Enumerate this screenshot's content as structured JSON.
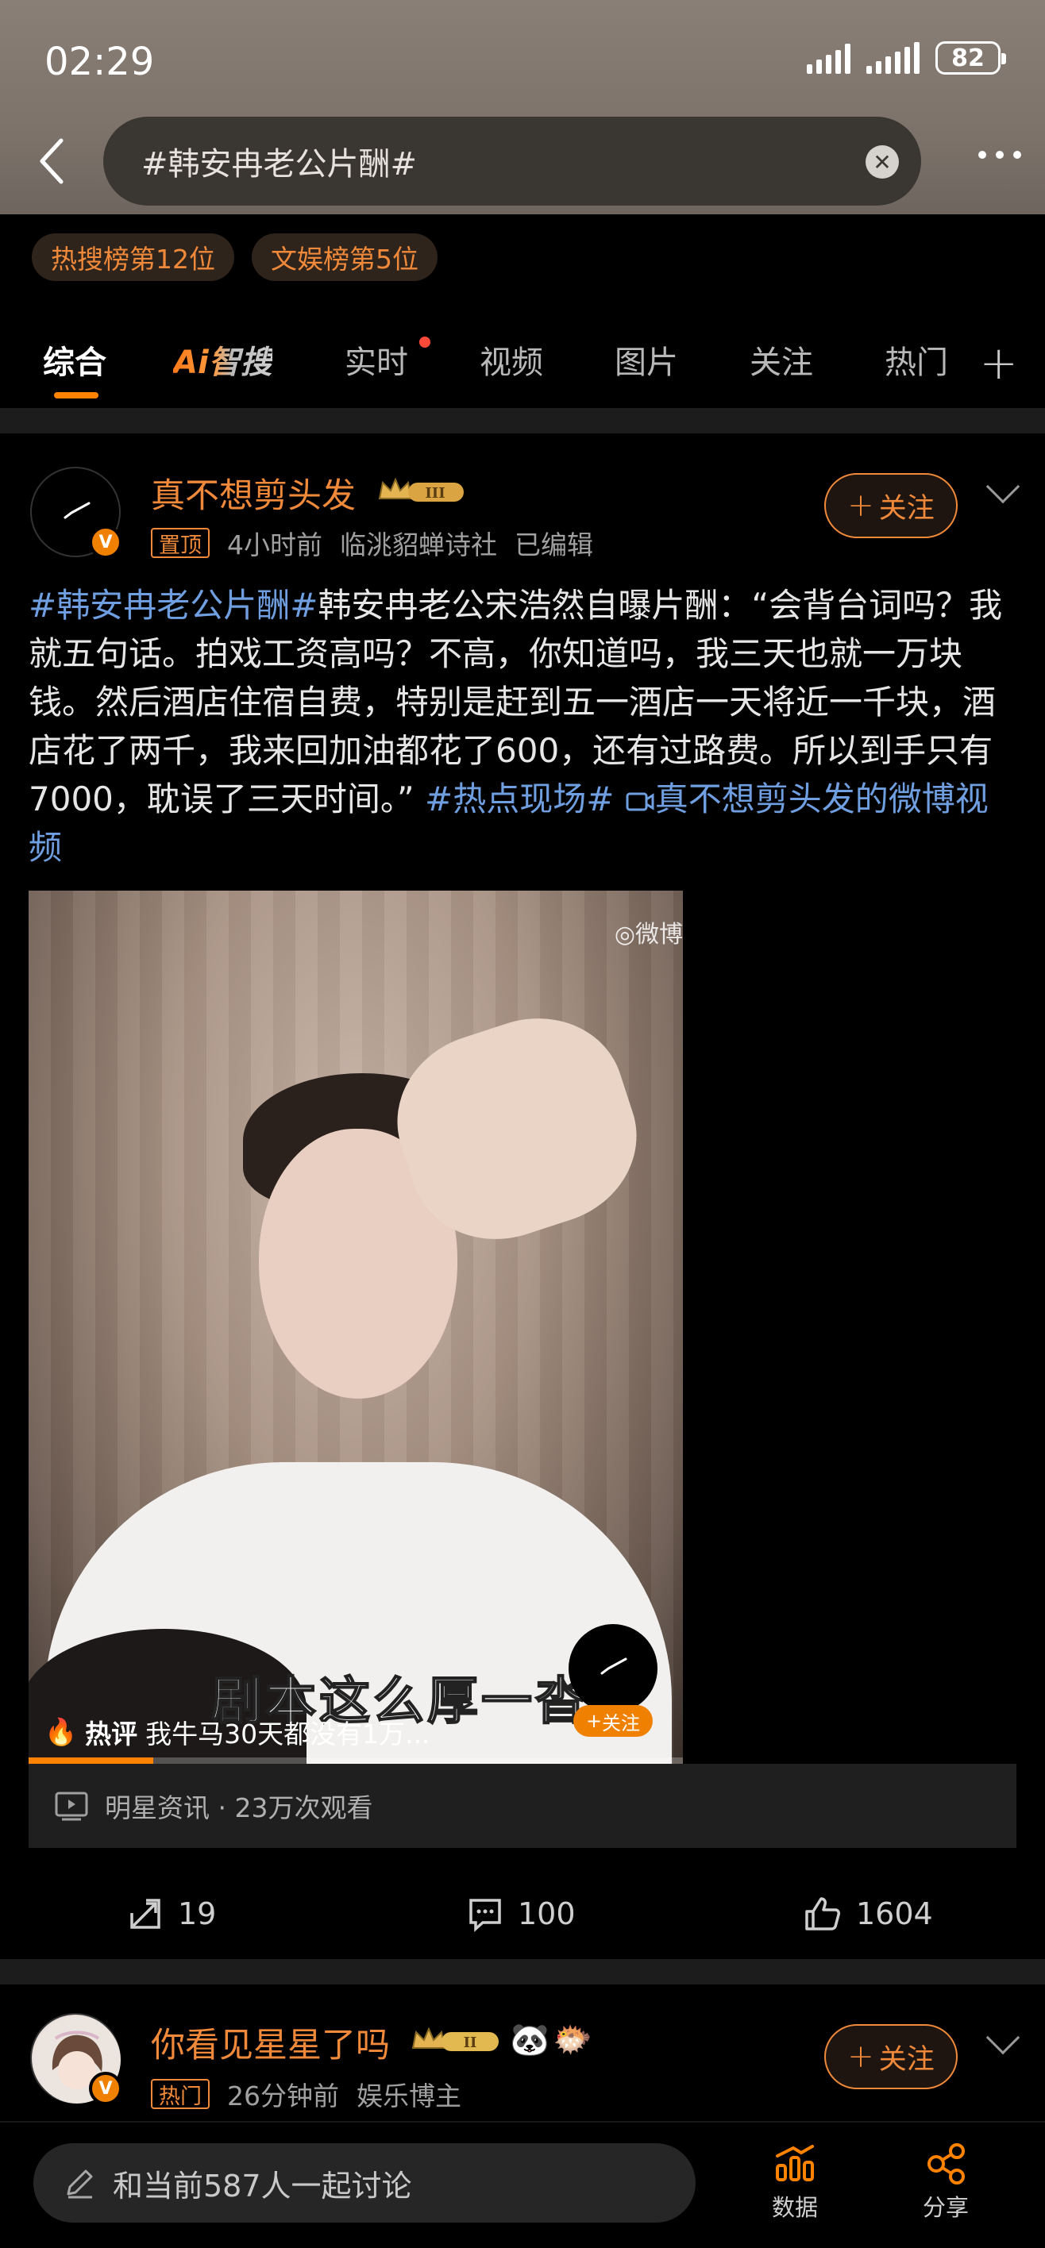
{
  "status": {
    "time": "02:29",
    "battery": "82"
  },
  "search": {
    "query": "#韩安冉老公片酬#"
  },
  "ranks": [
    "热搜榜第12位",
    "文娱榜第5位"
  ],
  "tabs": [
    {
      "label": "综合"
    },
    {
      "label": "智搜",
      "prefix": "Ai"
    },
    {
      "label": "实时"
    },
    {
      "label": "视频"
    },
    {
      "label": "图片"
    },
    {
      "label": "关注"
    },
    {
      "label": "热门"
    }
  ],
  "post1": {
    "username": "真不想剪头发",
    "level": "III",
    "pin": "置顶",
    "time": "4小时前",
    "source": "临洮貂蝉诗社",
    "edited": "已编辑",
    "follow": "关注",
    "text_hashtag1": "#韩安冉老公片酬#",
    "text_body": "韩安冉老公宋浩然自曝片酬：“会背台词吗？我就五句话。拍戏工资高吗？不高，你知道吗，我三天也就一万块钱。然后酒店住宿自费，特别是赶到五一酒店一天将近一千块，酒店花了两千，我来回加油都花了600，还有过路费。所以到手只有7000，耽误了三天时间。”",
    "text_hashtag2": "#热点现场#",
    "text_link": "真不想剪头发的微博视频",
    "video": {
      "watermark": "微博",
      "caption": "剧本这么厚一沓",
      "hot_label": "热评",
      "hot_comment": "我牛马30天都没有1万...",
      "mini_follow": "关注",
      "progress": 0.19
    },
    "video_source": "明星资讯 · 23万次观看",
    "reposts": "19",
    "comments": "100",
    "likes": "1604"
  },
  "post2": {
    "username": "你看见星星了吗",
    "level": "II",
    "tag": "热门",
    "time": "26分钟前",
    "source": "娱乐博主",
    "follow": "关注"
  },
  "bottom": {
    "placeholder": "和当前587人一起讨论",
    "data_label": "数据",
    "share_label": "分享"
  },
  "colors": {
    "accent": "#ff8200",
    "orange_text": "#f08a3a",
    "link": "#6f9fe0"
  }
}
